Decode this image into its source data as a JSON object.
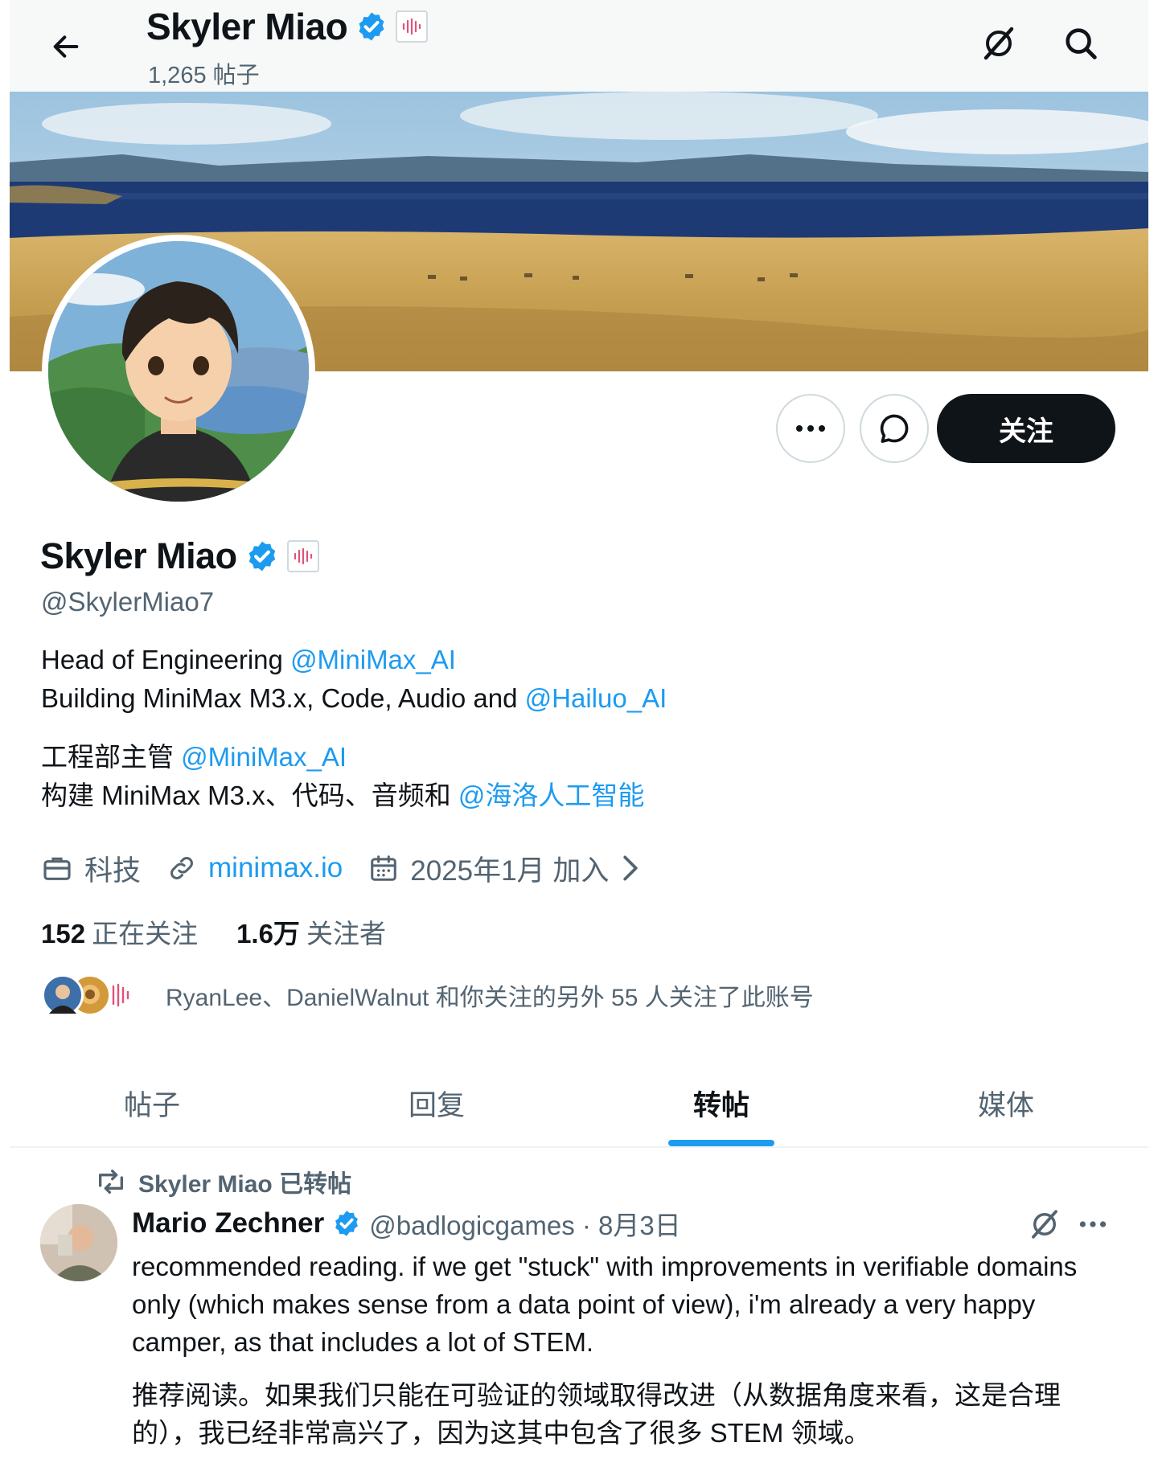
{
  "header": {
    "name": "Skyler Miao",
    "post_count": "1,265 帖子"
  },
  "profile": {
    "name": "Skyler Miao",
    "handle": "@SkylerMiao7",
    "follow_label": "关注",
    "bio": {
      "line1_text": "Head of Engineering ",
      "line1_link": "@MiniMax_AI",
      "line2_text": "Building MiniMax M3.x, Code, Audio and ",
      "line2_link": "@Hailuo_AI",
      "line3_text": "工程部主管 ",
      "line3_link": "@MiniMax_AI",
      "line4_text": "构建 MiniMax M3.x、代码、音频和 ",
      "line4_link": "@海洛人工智能"
    },
    "meta": {
      "category": "科技",
      "website": "minimax.io",
      "joined": "2025年1月 加入"
    },
    "stats": {
      "following_count": "152",
      "following_label": "正在关注",
      "followers_count": "1.6万",
      "followers_label": "关注者"
    },
    "followed_by": "RyanLee、DanielWalnut 和你关注的另外 55 人关注了此账号"
  },
  "tabs": [
    {
      "label": "帖子",
      "active": false
    },
    {
      "label": "回复",
      "active": false
    },
    {
      "label": "转帖",
      "active": true
    },
    {
      "label": "媒体",
      "active": false
    }
  ],
  "post": {
    "reposted_by": "Skyler Miao 已转帖",
    "author": "Mario Zechner",
    "handle_date": "@badlogicgames · 8月3日",
    "text_en": "recommended reading. if we get \"stuck\" with improvements in verifiable domains only (which makes sense from a data point of view), i'm already a very happy camper, as that includes a lot of STEM.",
    "text_zh": "推荐阅读。如果我们只能在可验证的领域取得改进（从数据角度来看，这是合理的），我已经非常高兴了，因为这其中包含了很多 STEM 领域。"
  },
  "colors": {
    "accent": "#1d9bf0",
    "text_primary": "#0f1419",
    "text_secondary": "#536471",
    "follow_button_bg": "#0f1419"
  },
  "icons": [
    "back-arrow-icon",
    "grok-icon",
    "search-icon",
    "verified-badge-icon",
    "affiliate-badge-icon",
    "more-icon",
    "message-icon",
    "briefcase-icon",
    "link-icon",
    "calendar-icon",
    "chevron-right-icon",
    "repost-icon"
  ]
}
